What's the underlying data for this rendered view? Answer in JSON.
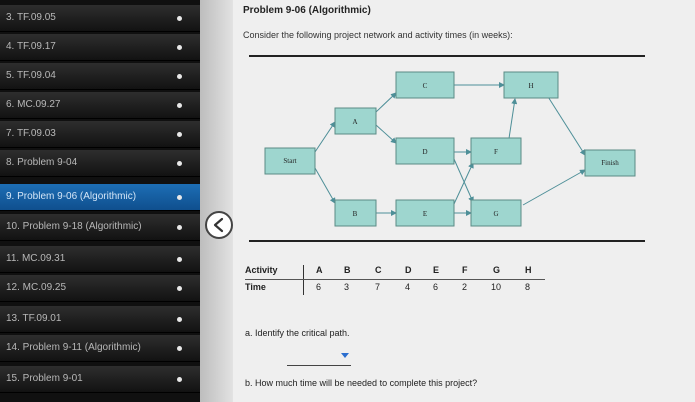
{
  "sidebar": {
    "items": [
      {
        "label": "3. TF.09.05",
        "active": false
      },
      {
        "label": "4. TF.09.17",
        "active": false
      },
      {
        "label": "5. TF.09.04",
        "active": false
      },
      {
        "label": "6. MC.09.27",
        "active": false
      },
      {
        "label": "7. TF.09.03",
        "active": false
      },
      {
        "label": "8. Problem 9-04",
        "active": false
      },
      {
        "label": "9. Problem 9-06 (Algorithmic)",
        "active": true
      },
      {
        "label": "10. Problem 9-18 (Algorithmic)",
        "active": false
      },
      {
        "label": "11. MC.09.31",
        "active": false
      },
      {
        "label": "12. MC.09.25",
        "active": false
      },
      {
        "label": "13. TF.09.01",
        "active": false
      },
      {
        "label": "14. Problem 9-11 (Algorithmic)",
        "active": false
      },
      {
        "label": "15. Problem 9-01",
        "active": false
      }
    ]
  },
  "colors": {
    "active_item": "#1d6eb5",
    "node_fill": "#9ed6cf",
    "edge": "#4e8f98",
    "dropdown_arrow": "#2b6ecf"
  },
  "main": {
    "title": "Problem 9-06 (Algorithmic)",
    "intro": "Consider the following project network and activity times (in weeks):",
    "network": {
      "nodes": {
        "start": "Start",
        "a": "A",
        "b": "B",
        "c": "C",
        "d": "D",
        "e": "E",
        "f": "F",
        "g": "G",
        "h": "H",
        "finish": "Finish"
      }
    },
    "table": {
      "row1_label": "Activity",
      "row2_label": "Time",
      "activities": [
        "A",
        "B",
        "C",
        "D",
        "E",
        "F",
        "G",
        "H"
      ],
      "times": [
        "6",
        "3",
        "7",
        "4",
        "6",
        "2",
        "10",
        "8"
      ]
    },
    "question_a": "a. Identify the critical path.",
    "question_b": "b. How much time will be needed to complete this project?"
  }
}
